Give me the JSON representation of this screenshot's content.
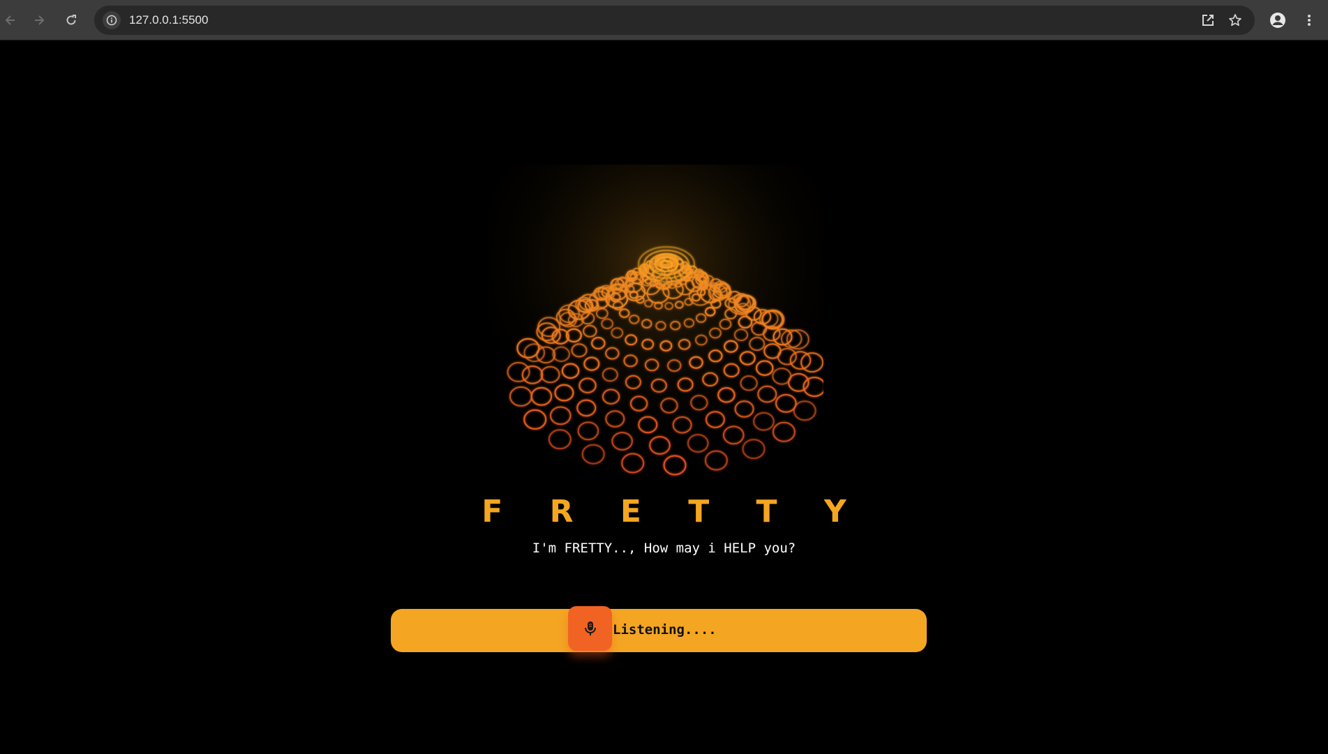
{
  "browser": {
    "url": "127.0.0.1:5500",
    "icons": {
      "back": "arrow-left-icon",
      "forward": "arrow-right-icon",
      "reload": "reload-icon",
      "site_info": "info-icon",
      "open_external": "open-in-new-icon",
      "bookmark": "star-icon",
      "profile": "person-icon",
      "menu": "more-vert-icon"
    }
  },
  "app": {
    "title": "F R E T T Y",
    "greeting": "I'm FRETTY.., How may i HELP you?",
    "status": "Listening....",
    "mic_icon": "microphone-icon"
  },
  "colors": {
    "background": "#000000",
    "accent": "#f4a623",
    "mic_button": "#f06323",
    "orb_primary": "#f5a623",
    "orb_secondary": "#e8501e"
  }
}
